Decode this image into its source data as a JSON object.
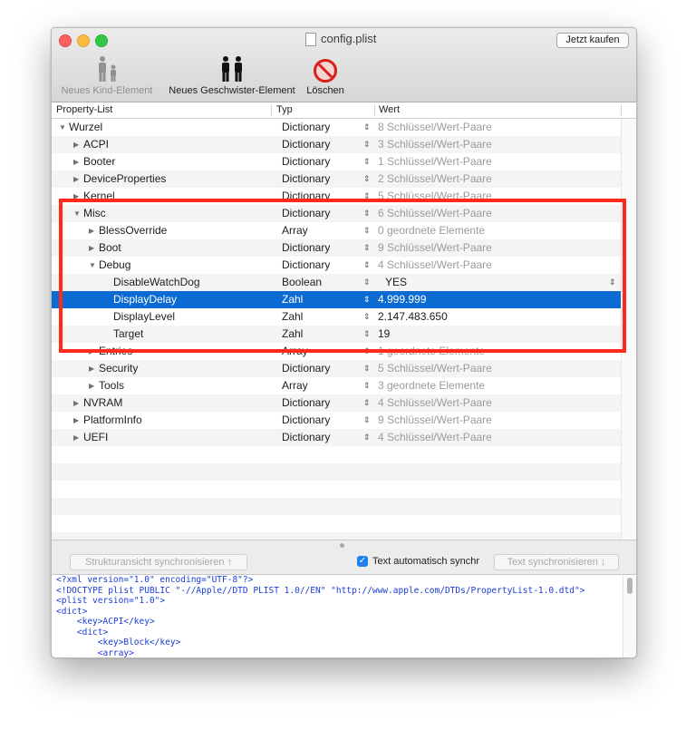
{
  "window": {
    "title": "config.plist",
    "buy_button": "Jetzt kaufen"
  },
  "toolbar": {
    "new_child": "Neues Kind-Element",
    "new_sibling": "Neues Geschwister-Element",
    "delete": "Löschen"
  },
  "columns": {
    "key": "Property-List",
    "type": "Typ",
    "value": "Wert"
  },
  "rows": [
    {
      "name": "Wurzel",
      "type": "Dictionary",
      "value": "8 Schlüssel/Wert-Paare"
    },
    {
      "name": "ACPI",
      "type": "Dictionary",
      "value": "3 Schlüssel/Wert-Paare"
    },
    {
      "name": "Booter",
      "type": "Dictionary",
      "value": "1 Schlüssel/Wert-Paare"
    },
    {
      "name": "DeviceProperties",
      "type": "Dictionary",
      "value": "2 Schlüssel/Wert-Paare"
    },
    {
      "name": "Kernel",
      "type": "Dictionary",
      "value": "5 Schlüssel/Wert-Paare"
    },
    {
      "name": "Misc",
      "type": "Dictionary",
      "value": "6 Schlüssel/Wert-Paare"
    },
    {
      "name": "BlessOverride",
      "type": "Array",
      "value": "0 geordnete Elemente"
    },
    {
      "name": "Boot",
      "type": "Dictionary",
      "value": "9 Schlüssel/Wert-Paare"
    },
    {
      "name": "Debug",
      "type": "Dictionary",
      "value": "4 Schlüssel/Wert-Paare"
    },
    {
      "name": "DisableWatchDog",
      "type": "Boolean",
      "value": "YES"
    },
    {
      "name": "DisplayDelay",
      "type": "Zahl",
      "value": "4.999.999"
    },
    {
      "name": "DisplayLevel",
      "type": "Zahl",
      "value": "2.147.483.650"
    },
    {
      "name": "Target",
      "type": "Zahl",
      "value": "19"
    },
    {
      "name": "Entries",
      "type": "Array",
      "value": "1 geordnete Elemente"
    },
    {
      "name": "Security",
      "type": "Dictionary",
      "value": "5 Schlüssel/Wert-Paare"
    },
    {
      "name": "Tools",
      "type": "Array",
      "value": "3 geordnete Elemente"
    },
    {
      "name": "NVRAM",
      "type": "Dictionary",
      "value": "4 Schlüssel/Wert-Paare"
    },
    {
      "name": "PlatformInfo",
      "type": "Dictionary",
      "value": "9 Schlüssel/Wert-Paare"
    },
    {
      "name": "UEFI",
      "type": "Dictionary",
      "value": "4 Schlüssel/Wert-Paare"
    }
  ],
  "xml_panel": {
    "sync_structure": "Strukturansicht synchronisieren ↑",
    "auto_text": "Text automatisch synchr",
    "sync_text": "Text synchronisieren ↓",
    "lines": [
      "<?xml version=\"1.0\" encoding=\"UTF-8\"?>",
      "<!DOCTYPE plist PUBLIC \"-//Apple//DTD PLIST 1.0//EN\" \"http://www.apple.com/DTDs/PropertyList-1.0.dtd\">",
      "<plist version=\"1.0\">",
      "<dict>",
      "    <key>ACPI</key>",
      "    <dict>",
      "        <key>Block</key>",
      "        <array>"
    ]
  }
}
